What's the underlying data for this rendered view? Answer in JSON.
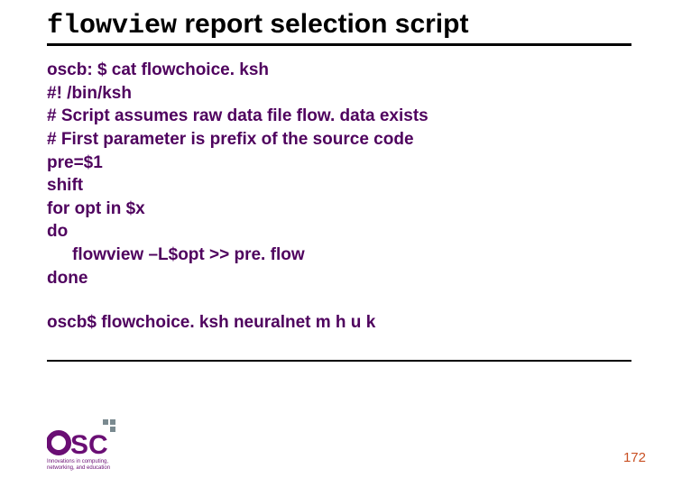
{
  "title": {
    "mono": "flowview",
    "rest": " report selection script"
  },
  "code": {
    "l1": "oscb: $ cat flowchoice. ksh",
    "l2": "#! /bin/ksh",
    "l3": "# Script assumes raw data file flow. data exists",
    "l4": "# First parameter is prefix of the source code",
    "l5": "pre=$1",
    "l6": "shift",
    "l7": "for opt in $x",
    "l8": "do",
    "l9": "flowview –L$opt >> pre. flow",
    "l10": "done",
    "l11": "oscb$ flowchoice. ksh neuralnet m h u k"
  },
  "footer": {
    "page": "172",
    "logo_primary": "OSC",
    "logo_sub": "Innovations in computing,\nnetworking, and education"
  }
}
